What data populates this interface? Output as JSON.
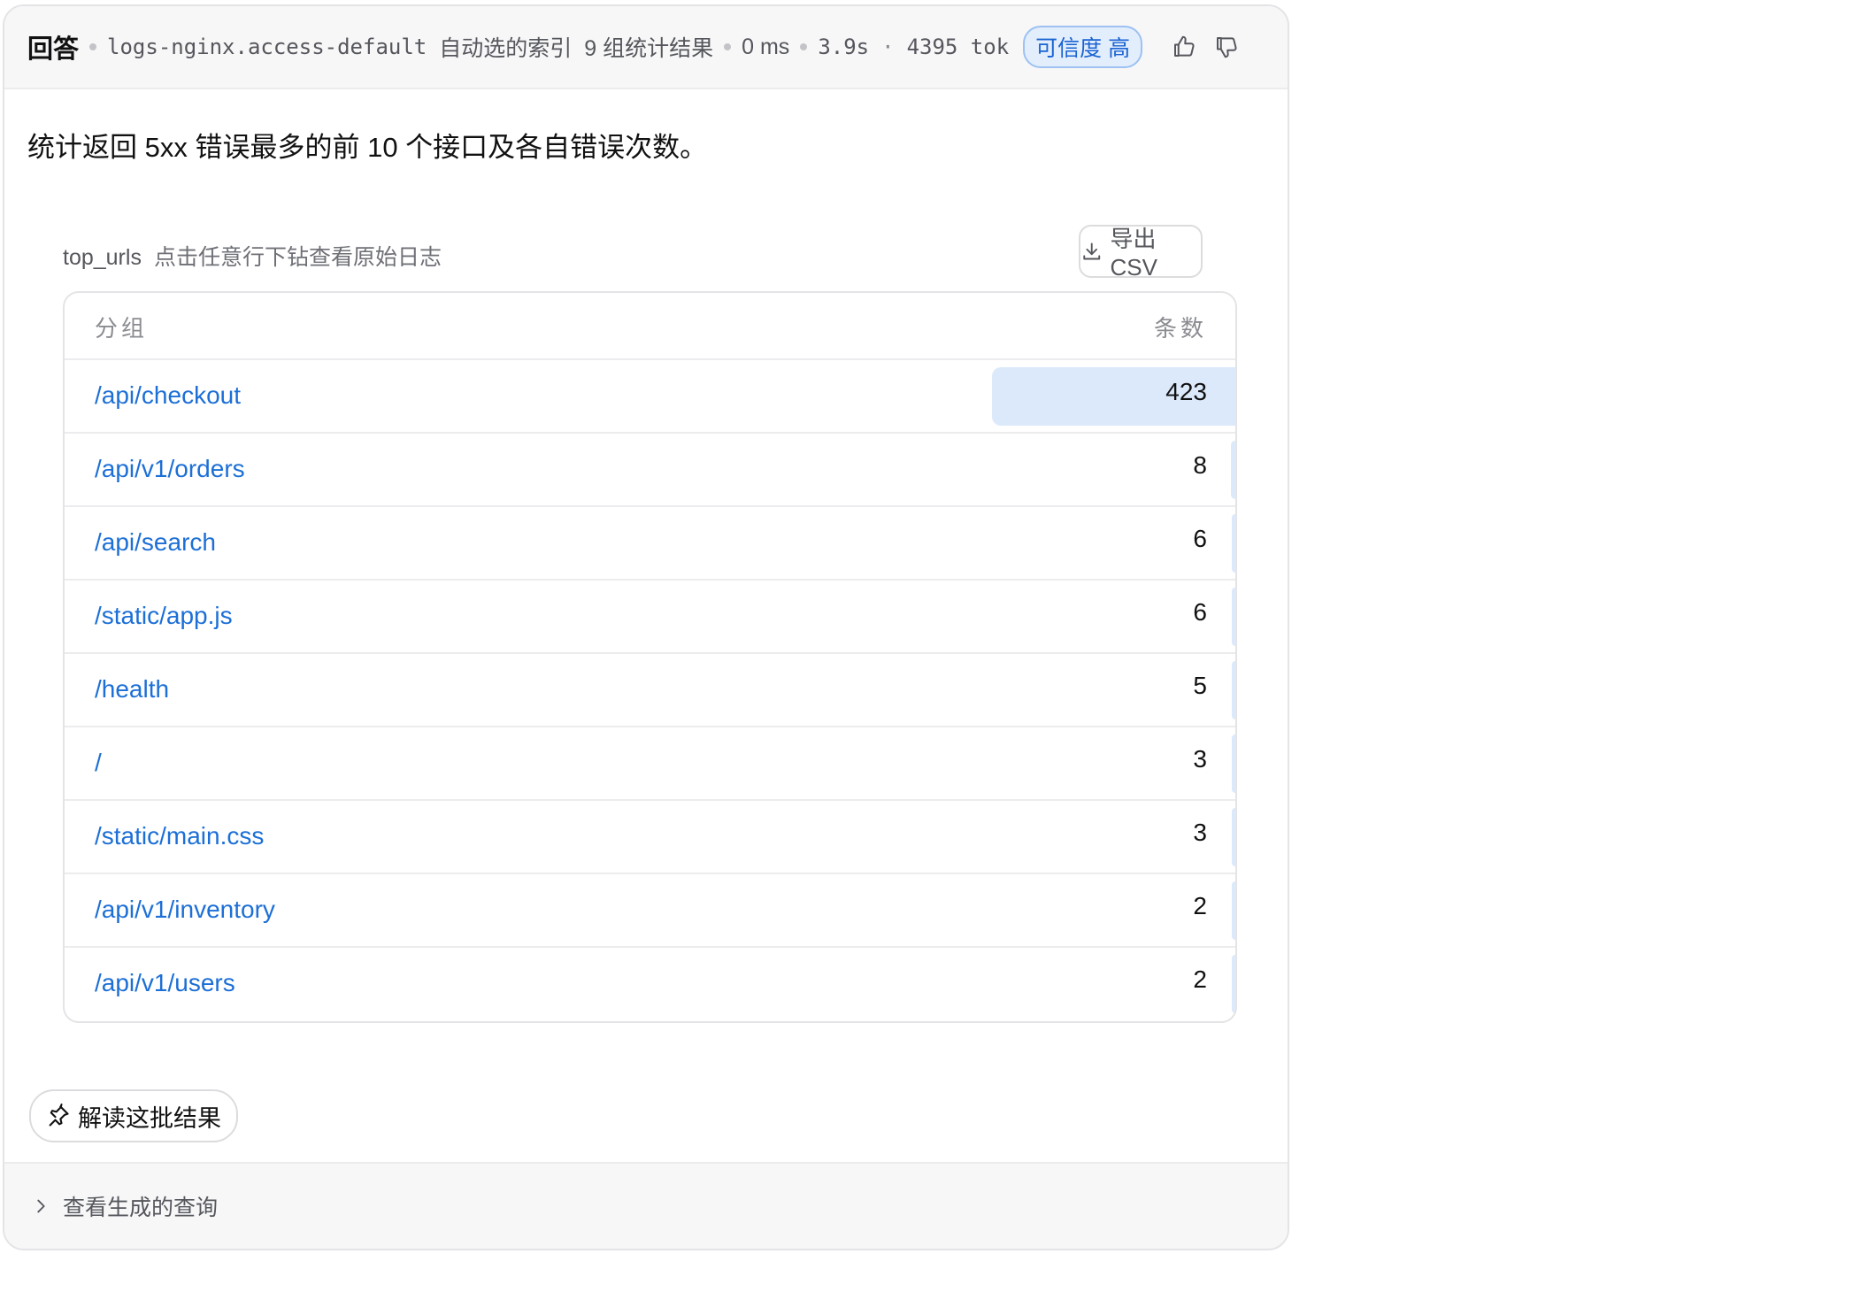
{
  "header": {
    "title": "回答",
    "index": "logs-nginx.access-default",
    "index_note": "自动选的索引",
    "group_count": "9 组统计结果",
    "latency": "0 ms",
    "duration": "3.9s",
    "tokens": "4395 tok",
    "confidence": "可信度 高",
    "icons": [
      "thumbs-up-icon",
      "thumbs-down-icon"
    ]
  },
  "question": "统计返回 5xx 错误最多的前 10 个接口及各自错误次数。",
  "table": {
    "name": "top_urls",
    "hint": "点击任意行下钻查看原始日志",
    "export_label": "导出 CSV",
    "col_group": "分组",
    "col_count": "条数",
    "rows": [
      {
        "url": "/api/checkout",
        "count": 423
      },
      {
        "url": "/api/v1/orders",
        "count": 8
      },
      {
        "url": "/api/search",
        "count": 6
      },
      {
        "url": "/static/app.js",
        "count": 6
      },
      {
        "url": "/health",
        "count": 5
      },
      {
        "url": "/",
        "count": 3
      },
      {
        "url": "/static/main.css",
        "count": 3
      },
      {
        "url": "/api/v1/inventory",
        "count": 2
      },
      {
        "url": "/api/v1/users",
        "count": 2
      }
    ]
  },
  "interpret_label": "解读这批结果",
  "footer": {
    "label": "查看生成的查询"
  },
  "colors": {
    "accent": "#1c6fd6",
    "bar": "#dce9fb",
    "badge_bg": "#e3eefd"
  }
}
